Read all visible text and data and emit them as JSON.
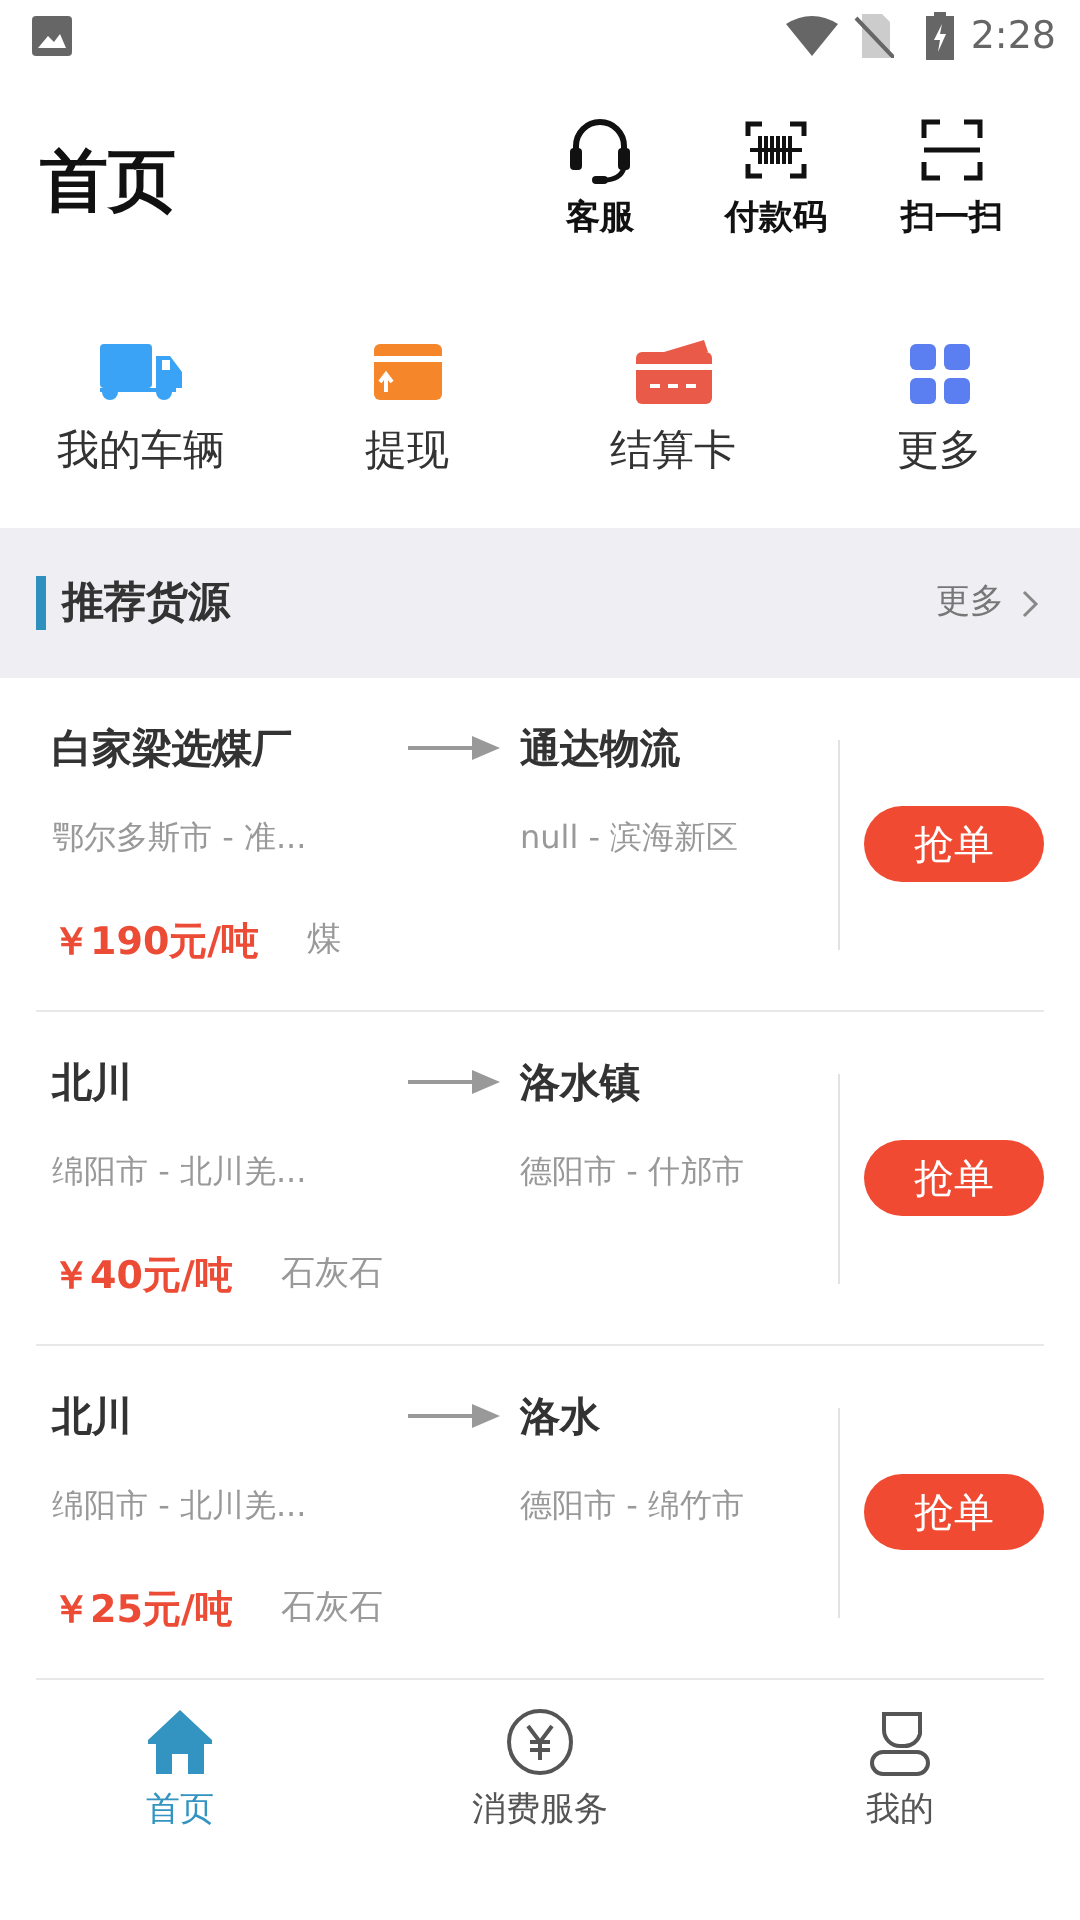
{
  "status_bar": {
    "time": "2:28"
  },
  "header": {
    "title": "首页",
    "actions": [
      {
        "label": "客服",
        "kind": "headset"
      },
      {
        "label": "付款码",
        "kind": "barcode"
      },
      {
        "label": "扫一扫",
        "kind": "scan"
      }
    ]
  },
  "shortcuts": [
    {
      "label": "我的车辆",
      "kind": "truck"
    },
    {
      "label": "提现",
      "kind": "withdraw"
    },
    {
      "label": "结算卡",
      "kind": "card"
    },
    {
      "label": "更多",
      "kind": "grid"
    }
  ],
  "section": {
    "title": "推荐货源",
    "more": "更多"
  },
  "cargo": [
    {
      "from": "白家梁选煤厂",
      "to": "通达物流",
      "from_area": "鄂尔多斯市 - 准...",
      "to_area": "null - 滨海新区",
      "price": "￥190元/吨",
      "goods": "煤",
      "action": "抢单"
    },
    {
      "from": "北川",
      "to": "洛水镇",
      "from_area": "绵阳市 - 北川羌...",
      "to_area": "德阳市 - 什邡市",
      "price": "￥40元/吨",
      "goods": "石灰石",
      "action": "抢单"
    },
    {
      "from": "北川",
      "to": "洛水",
      "from_area": "绵阳市 - 北川羌...",
      "to_area": "德阳市 - 绵竹市",
      "price": "￥25元/吨",
      "goods": "石灰石",
      "action": "抢单"
    }
  ],
  "tabbar": [
    {
      "label": "首页",
      "kind": "home",
      "selected": true
    },
    {
      "label": "消费服务",
      "kind": "yen",
      "selected": false
    },
    {
      "label": "我的",
      "kind": "user",
      "selected": false
    }
  ]
}
